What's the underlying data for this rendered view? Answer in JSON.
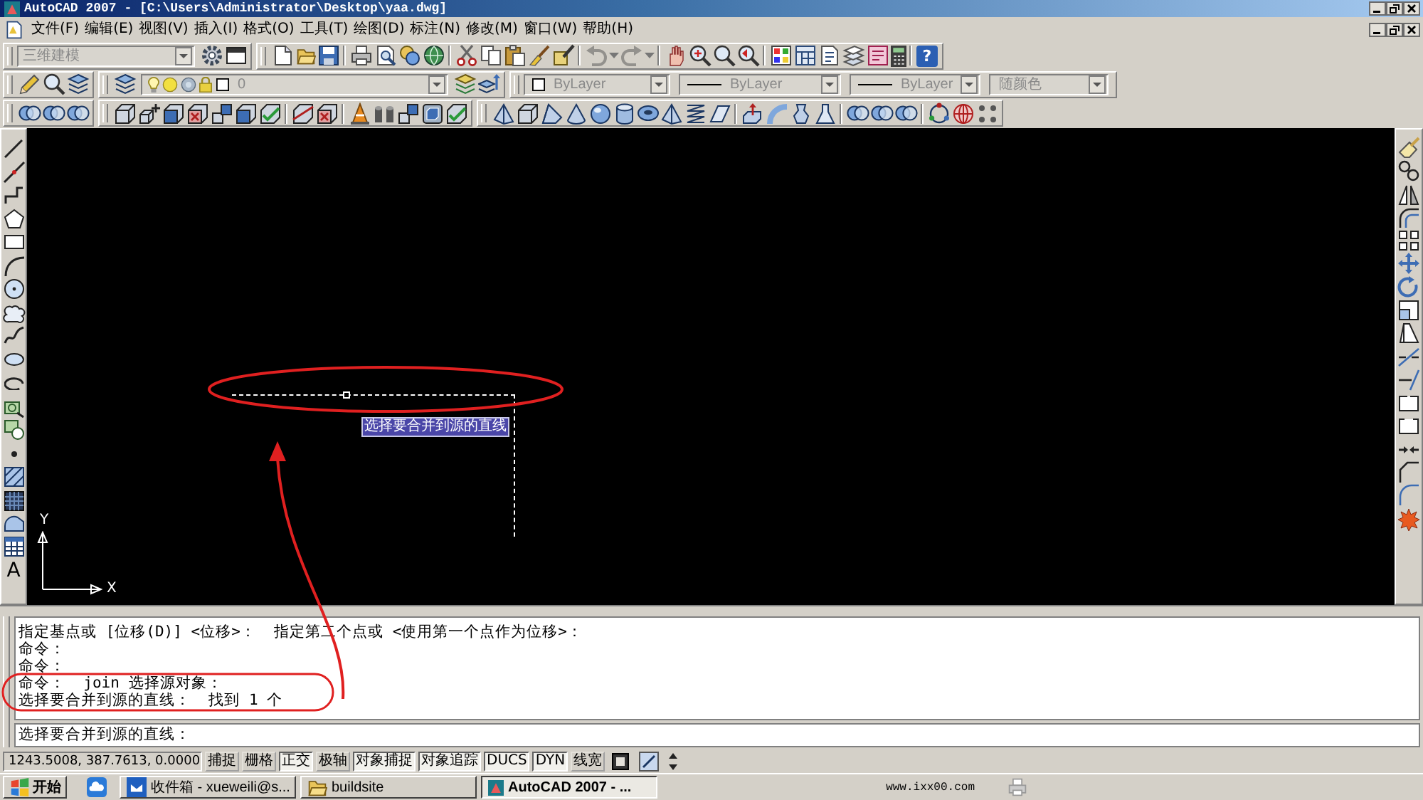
{
  "window": {
    "title": "AutoCAD 2007 - [C:\\Users\\Administrator\\Desktop\\yaa.dwg]"
  },
  "menu_bar": {
    "items": [
      "文件(F)",
      "编辑(E)",
      "视图(V)",
      "插入(I)",
      "格式(O)",
      "工具(T)",
      "绘图(D)",
      "标注(N)",
      "修改(M)",
      "窗口(W)",
      "帮助(H)"
    ]
  },
  "toolbars": {
    "workspace": {
      "value": "三维建模",
      "disabled": true
    },
    "undo": {
      "disabled": true
    },
    "redo": {
      "disabled": true
    },
    "help_glyph": "?",
    "layer": {
      "value": "0",
      "disabled": true
    },
    "color": {
      "value": "ByLayer",
      "disabled": true
    },
    "linetype": {
      "value": "ByLayer",
      "disabled": true
    },
    "lineweight": {
      "value": "ByLayer",
      "disabled": true
    },
    "plot_style": {
      "value": "随颜色",
      "disabled": true
    }
  },
  "draw_toolbar": {
    "text_tool": "A"
  },
  "drawing_area": {
    "tooltip": "选择要合并到源的直线",
    "ucs": {
      "y_axis": "Y",
      "x_axis": "X"
    }
  },
  "command_window": {
    "history": [
      "指定基点或 [位移(D)] <位移>：  指定第二个点或 <使用第一个点作为位移>：",
      "命令：",
      "命令：",
      "命令：  join 选择源对象：",
      "选择要合并到源的直线：  找到 1 个"
    ],
    "prompt": "选择要合并到源的直线："
  },
  "status_bar": {
    "coordinates": "1243.5008, 387.7613, 0.0000",
    "toggles": [
      {
        "label": "捕捉",
        "on": false
      },
      {
        "label": "栅格",
        "on": false
      },
      {
        "label": "正交",
        "on": true
      },
      {
        "label": "极轴",
        "on": false
      },
      {
        "label": "对象捕捉",
        "on": true
      },
      {
        "label": "对象追踪",
        "on": true
      },
      {
        "label": "DUCS",
        "on": true
      },
      {
        "label": "DYN",
        "on": true
      },
      {
        "label": "线宽",
        "on": false
      }
    ]
  },
  "taskbar": {
    "start": "开始",
    "tasks": [
      {
        "kind": "mail",
        "label": "收件箱 - xueweili@s...",
        "selected": false
      },
      {
        "kind": "folder",
        "label": "buildsite",
        "selected": false
      },
      {
        "kind": "app",
        "label": "AutoCAD 2007 - ...",
        "selected": true
      }
    ],
    "tray_text": "www.ixx00.com"
  }
}
